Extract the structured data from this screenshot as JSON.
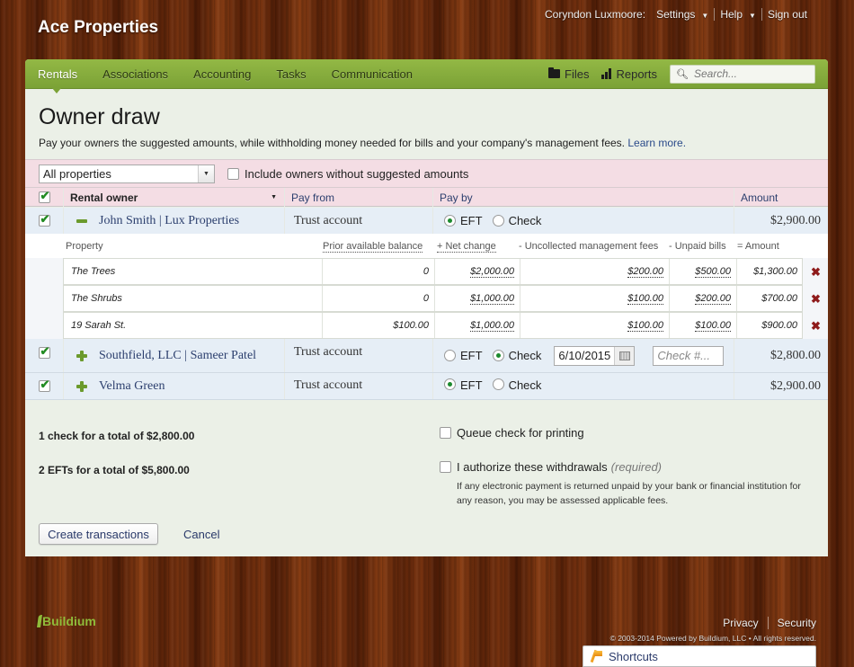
{
  "app": {
    "brand": "Ace Properties"
  },
  "topnav": {
    "user": "Coryndon Luxmoore:",
    "settings": "Settings",
    "help": "Help",
    "signout": "Sign out"
  },
  "mainnav": {
    "tabs": [
      "Rentals",
      "Associations",
      "Accounting",
      "Tasks",
      "Communication"
    ],
    "active_tab": "Rentals",
    "files": "Files",
    "reports": "Reports",
    "search_placeholder": "Search..."
  },
  "page": {
    "title": "Owner draw",
    "description": "Pay your owners the suggested amounts, while withholding money needed for bills and your company's management fees.",
    "learn_more": "Learn more."
  },
  "filters": {
    "property_select": "All properties",
    "include_label": "Include owners without suggested amounts",
    "include_checked": false
  },
  "table": {
    "headers": {
      "owner": "Rental owner",
      "pay_from": "Pay from",
      "pay_by": "Pay by",
      "amount": "Amount"
    },
    "select_all_checked": true,
    "pay_options": {
      "eft": "EFT",
      "check": "Check"
    },
    "owners": [
      {
        "name": "John Smith | Lux Properties",
        "pay_from": "Trust account",
        "pay_by": "EFT",
        "amount": "$2,900.00",
        "expanded": true,
        "checked": true
      },
      {
        "name": "Southfield, LLC | Sameer Patel",
        "pay_from": "Trust account",
        "pay_by": "Check",
        "amount": "$2,800.00",
        "expanded": false,
        "checked": true,
        "check_date": "6/10/2015",
        "check_number_placeholder": "Check #..."
      },
      {
        "name": "Velma Green",
        "pay_from": "Trust account",
        "pay_by": "EFT",
        "amount": "$2,900.00",
        "expanded": false,
        "checked": true
      }
    ],
    "property_headers": {
      "property": "Property",
      "prior_balance": "Prior available balance",
      "net_change": "+ Net change",
      "mgmt_fees": "- Uncollected management fees",
      "unpaid_bills": "- Unpaid bills",
      "amount": "= Amount"
    },
    "properties": [
      {
        "name": "The Trees",
        "prior_balance": "0",
        "net_change": "$2,000.00",
        "mgmt_fees": "$200.00",
        "unpaid_bills": "$500.00",
        "amount": "$1,300.00"
      },
      {
        "name": "The Shrubs",
        "prior_balance": "0",
        "net_change": "$1,000.00",
        "mgmt_fees": "$100.00",
        "unpaid_bills": "$200.00",
        "amount": "$700.00"
      },
      {
        "name": "19 Sarah St.",
        "prior_balance": "$100.00",
        "net_change": "$1,000.00",
        "mgmt_fees": "$100.00",
        "unpaid_bills": "$100.00",
        "amount": "$900.00"
      }
    ]
  },
  "summary": {
    "checks": "1 check for a total of $2,800.00",
    "efts": "2 EFTs for a total of $5,800.00",
    "queue_label": "Queue check for printing",
    "authorize_label": "I authorize these withdrawals",
    "required": "(required)",
    "note": "If any electronic payment is returned unpaid by your bank or financial institution for any reason, you may be assessed applicable fees."
  },
  "actions": {
    "create": "Create transactions",
    "cancel": "Cancel"
  },
  "footer": {
    "logo": "Buildium",
    "privacy": "Privacy",
    "security": "Security",
    "copyright": "© 2003-2014 Powered by Buildium, LLC • All rights reserved.",
    "shortcuts": "Shortcuts"
  }
}
